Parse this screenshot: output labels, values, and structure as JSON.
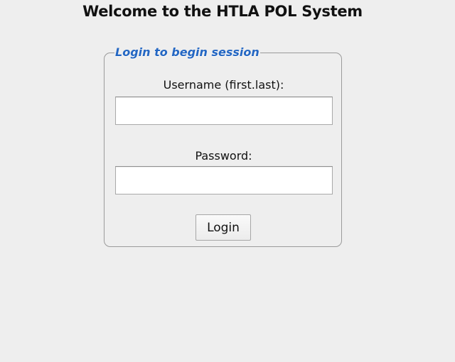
{
  "page": {
    "title": "Welcome to the HTLA POL System"
  },
  "login_form": {
    "legend": "Login to begin session",
    "username_label": "Username (first.last):",
    "username_value": "",
    "password_label": "Password:",
    "password_value": "",
    "login_label": "Login"
  },
  "colors": {
    "background": "#eeeeee",
    "legend_accent": "#2467c3",
    "border": "#9a9a9a"
  }
}
